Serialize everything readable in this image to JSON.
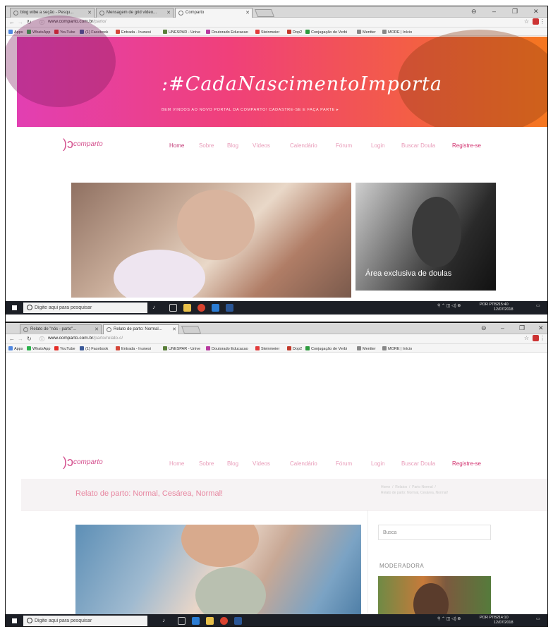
{
  "shot1": {
    "tabs": [
      {
        "title": "blog wibe a seção - Pesqu..."
      },
      {
        "title": "Mensagem de grid vídeo..."
      },
      {
        "title": "Comparto"
      }
    ],
    "window_controls": [
      "⊖",
      "–",
      "❐",
      "✕"
    ],
    "url_domain": "www.comparto.com.br",
    "url_path": "/parto/",
    "bookmarks": [
      {
        "label": "Apps",
        "color": "#4f87e0"
      },
      {
        "label": "WhatsApp",
        "color": "#2bb24c"
      },
      {
        "label": "YouTube",
        "color": "#e52d27"
      },
      {
        "label": "(1) Facebook",
        "color": "#3b5998"
      },
      {
        "label": "Entrada - Inunesi",
        "color": "#d44638"
      },
      {
        "label": "UNESPAR - Unive",
        "color": "#5a7f3a"
      },
      {
        "label": "Doutorado Educacao",
        "color": "#b83aa0"
      },
      {
        "label": "Steinmeier",
        "color": "#e23b3b"
      },
      {
        "label": "Dop2",
        "color": "#c2392b"
      },
      {
        "label": "Conjugação de Verbi",
        "color": "#2d9b3e"
      },
      {
        "label": "Mentter",
        "color": "#888888"
      },
      {
        "label": "MORE | Início",
        "color": "#888888"
      }
    ],
    "banner": {
      "hashtag": ":#CadaNascimentoImporta",
      "subtitle": "BEM VINDOS AO NOVO PORTAL DA COMPARTO! CADASTRE-SE E FAÇA PARTE ▸"
    },
    "side_caption": "Área exclusiva de doulas",
    "taskbar": {
      "search_placeholder": "Digite aqui para pesquisar",
      "tray_lang": "POR\nPTB2",
      "time": "15:40",
      "date": "12/07/2018"
    }
  },
  "site": {
    "logo": "comparto",
    "menu": [
      "Home",
      "Sobre",
      "Blog",
      "Vídeos",
      "Calendário",
      "Fórum",
      "Login",
      "Buscar Doula",
      "Registre-se"
    ]
  },
  "shot2": {
    "tabs": [
      {
        "title": "Relato de \"nós - parto\"..."
      },
      {
        "title": "Relato de parto: Normal..."
      }
    ],
    "window_controls": [
      "⊖",
      "–",
      "❐",
      "✕"
    ],
    "url_domain": "www.comparto.com.br",
    "url_path": "/parto/relato-c/",
    "page_title": "Relato de parto: Normal, Cesárea, Normal!",
    "breadcrumbs": "Home  /  Relatos  /  Parto Normal  /\nRelato de parto: Normal, Cesárea, Normal!",
    "search_placeholder": "Busca",
    "moderator_heading": "MODERADORA",
    "taskbar": {
      "search_placeholder": "Digite aqui para pesquisar",
      "tray_lang": "POR\nPTB2",
      "time": "14:10",
      "date": "12/07/2018"
    }
  },
  "colors": {
    "accent": "#d1316e",
    "menu": "#e89bb8",
    "banner_start": "#e23fb2",
    "banner_end": "#f5771f"
  }
}
